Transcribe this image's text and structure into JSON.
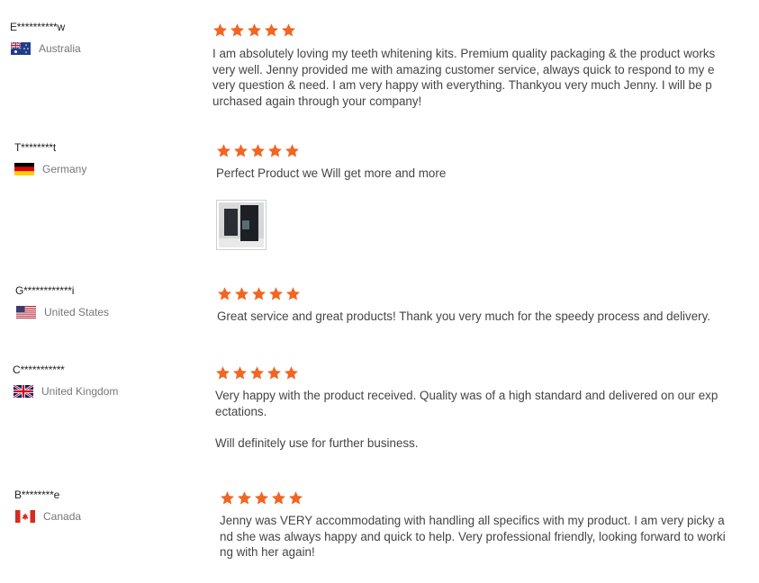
{
  "reviews": [
    {
      "name": "E**********w",
      "country": "Australia",
      "flag": "flag-au-icon",
      "rating": 5,
      "paragraphs": [
        "I am absolutely loving my teeth whitening kits. Premium quality packaging & the product works very well. Jenny provided me with amazing customer service, always quick to respond to my every question & need. I am very happy with everything. Thankyou very much Jenny. I will be purchased again through your company!"
      ],
      "has_image": false
    },
    {
      "name": "T********t",
      "country": "Germany",
      "flag": "flag-de-icon",
      "rating": 5,
      "paragraphs": [
        "Perfect Product we Will get more and more"
      ],
      "has_image": true
    },
    {
      "name": "G************i",
      "country": "United States",
      "flag": "flag-us-icon",
      "rating": 5,
      "paragraphs": [
        "Great service and great products! Thank you very much for the speedy process and delivery."
      ],
      "has_image": false
    },
    {
      "name": "C***********",
      "country": "United Kingdom",
      "flag": "flag-gb-icon",
      "rating": 5,
      "paragraphs": [
        "Very happy with the product received. Quality was of a high standard and delivered on our expectations.",
        "Will definitely use for further business."
      ],
      "has_image": false
    },
    {
      "name": "B********e",
      "country": "Canada",
      "flag": "flag-ca-icon",
      "rating": 5,
      "paragraphs": [
        "Jenny was VERY accommodating with handling all specifics with my product. I am very picky and she was always happy and quick to help. Very professional friendly, looking forward to working with her again!"
      ],
      "has_image": false
    }
  ],
  "colors": {
    "star": "#f26522",
    "name": "#222222",
    "country": "#777777",
    "text": "#444444"
  }
}
